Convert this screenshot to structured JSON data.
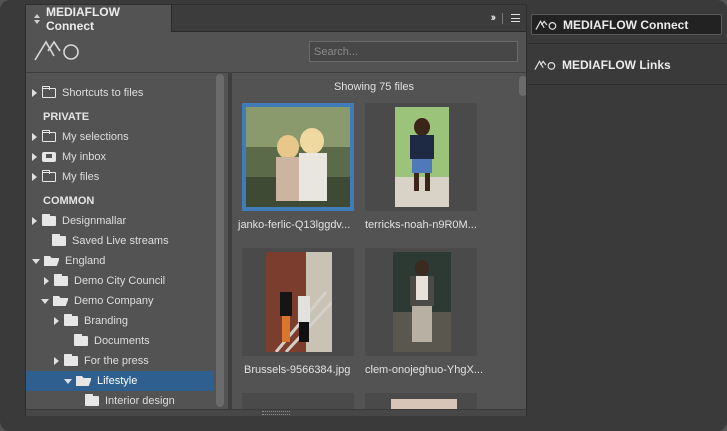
{
  "panel": {
    "tab_title": "MEDIAFLOW Connect",
    "collapse_glyph": "››",
    "search_placeholder": "Search..."
  },
  "tree": {
    "items": [
      {
        "label": "Shortcuts to files",
        "kind": "folder",
        "arrow": "right"
      },
      {
        "label": "PRIVATE",
        "kind": "section"
      },
      {
        "label": "My selections",
        "kind": "folder",
        "arrow": "right"
      },
      {
        "label": "My inbox",
        "kind": "inbox",
        "arrow": "right"
      },
      {
        "label": "My files",
        "kind": "folder",
        "arrow": "right"
      },
      {
        "label": "COMMON",
        "kind": "section"
      },
      {
        "label": "Designmallar",
        "kind": "folder-filled",
        "arrow": "right"
      },
      {
        "label": "Saved Live streams",
        "kind": "folder-filled",
        "arrow": "none"
      },
      {
        "label": "England",
        "kind": "folder-open",
        "arrow": "down"
      },
      {
        "label": "Demo City Council",
        "kind": "folder-filled",
        "arrow": "right"
      },
      {
        "label": "Demo Company",
        "kind": "folder-open",
        "arrow": "down"
      },
      {
        "label": "Branding",
        "kind": "folder-filled",
        "arrow": "right"
      },
      {
        "label": "Documents",
        "kind": "folder-filled",
        "arrow": "none"
      },
      {
        "label": "For the press",
        "kind": "folder-filled",
        "arrow": "right"
      },
      {
        "label": "Lifestyle",
        "kind": "folder-open",
        "arrow": "down",
        "selected": true
      },
      {
        "label": "Interior design",
        "kind": "folder-filled",
        "arrow": "none"
      }
    ]
  },
  "grid": {
    "status": "Showing 75 files",
    "files": [
      {
        "name": "janko-ferlic-Q13lggdv...",
        "selected": true
      },
      {
        "name": "terricks-noah-n9R0M..."
      },
      {
        "name": "Brussels-9566384.jpg"
      },
      {
        "name": "clem-onojeghuo-YhgX..."
      }
    ]
  },
  "dock": {
    "items": [
      {
        "label": "MEDIAFLOW Connect",
        "active": true
      },
      {
        "label": "MEDIAFLOW Links"
      }
    ]
  },
  "colors": {
    "selection": "#2f5f8f",
    "thumb_selection": "#3f7cb8",
    "panel_bg": "#535353"
  }
}
